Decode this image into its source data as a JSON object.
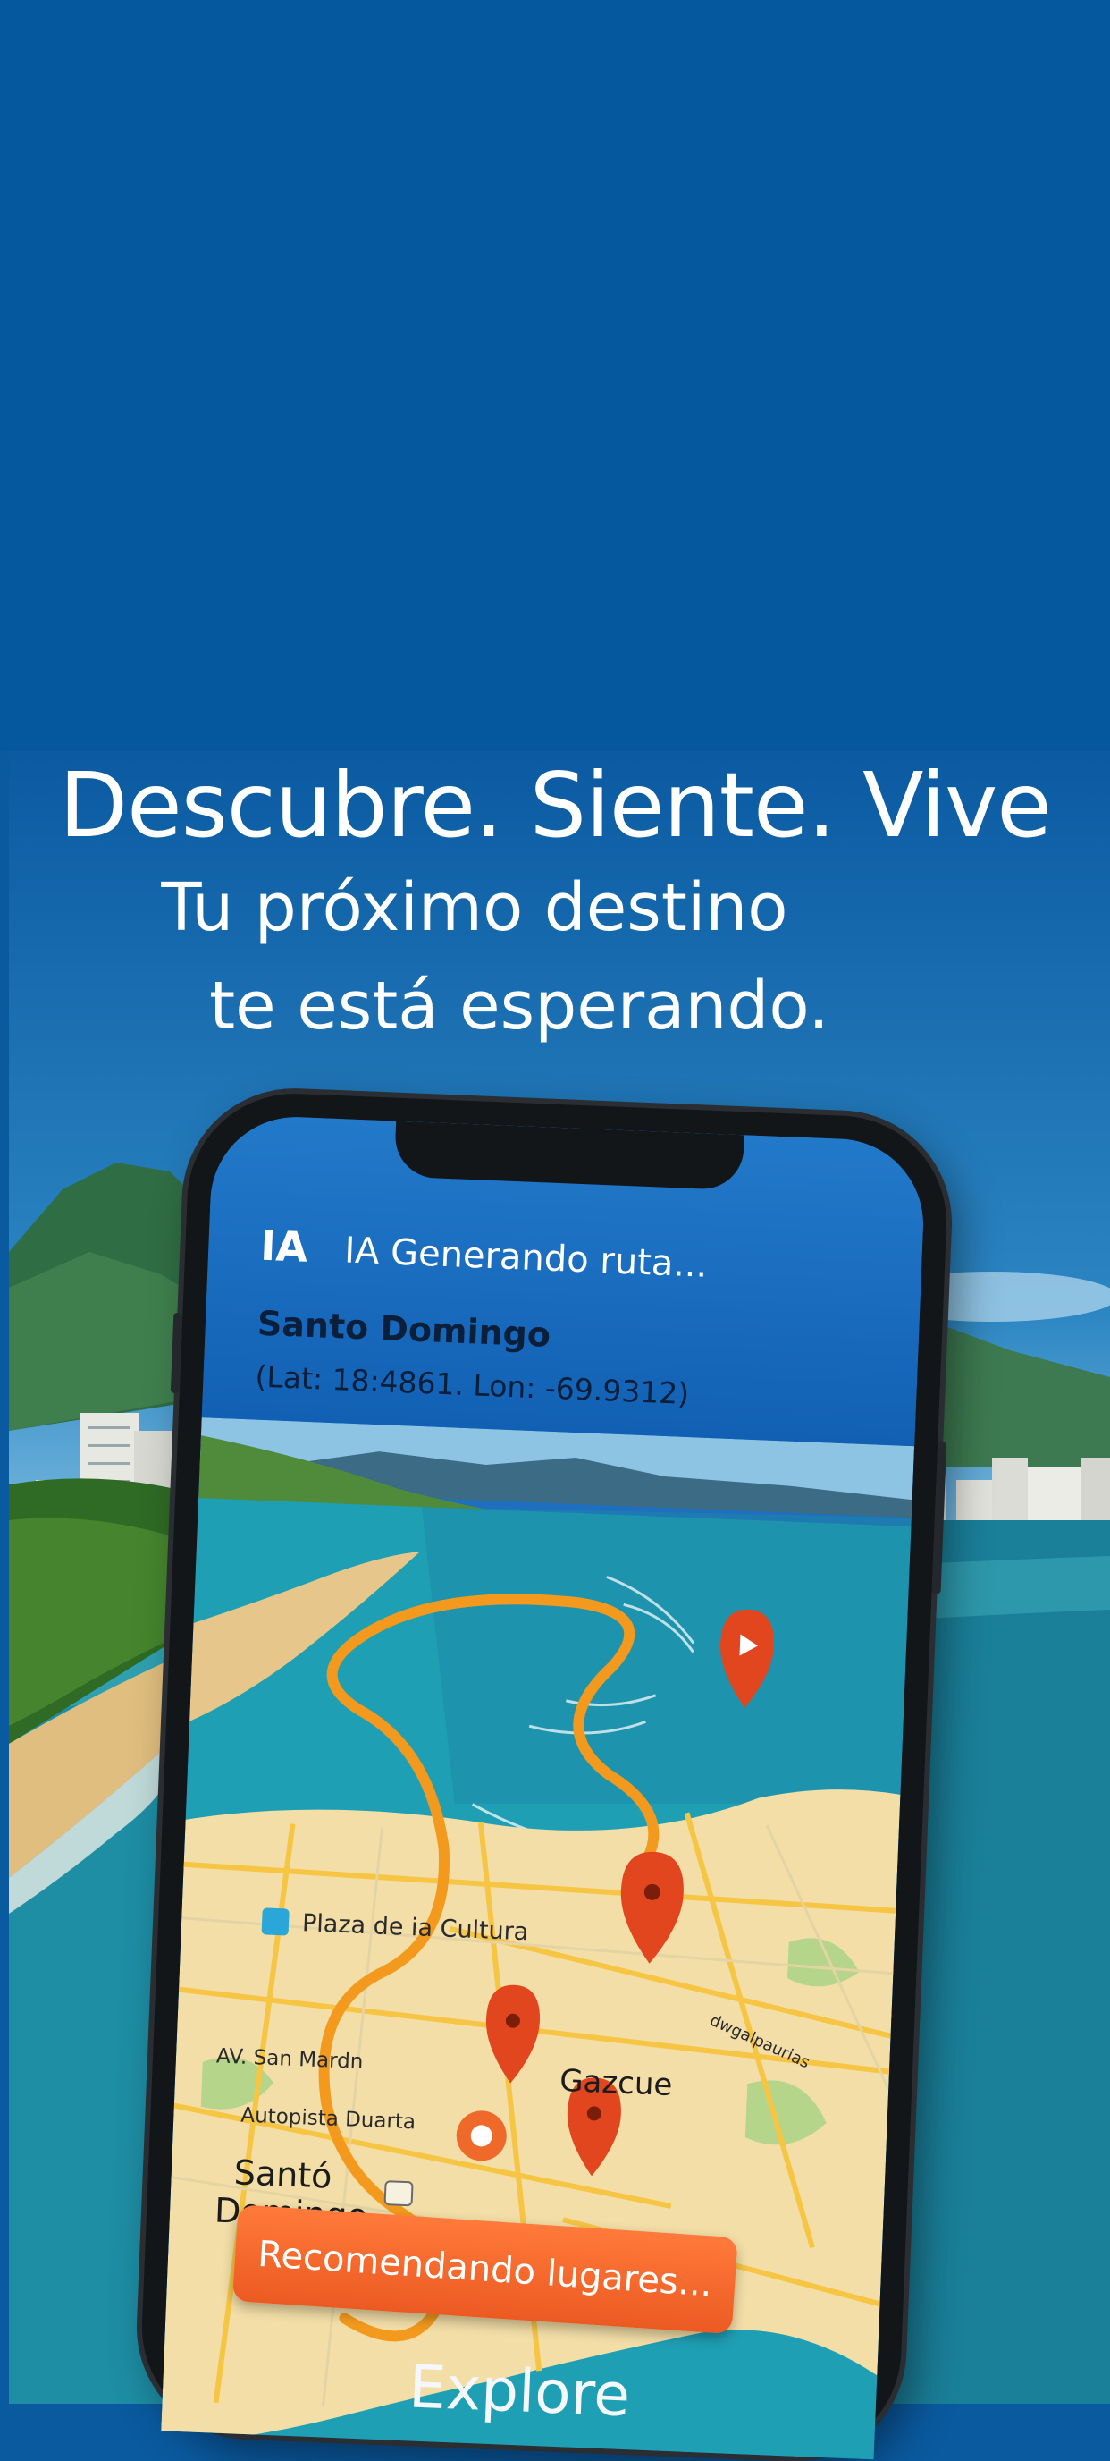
{
  "headline": {
    "title": "Descubre. Siente. Vive",
    "line1": "Tu próximo destino",
    "line2": "te está esperando."
  },
  "app": {
    "ia_badge": "IA",
    "route_status": "IA Generando ruta...",
    "location_name": "Santo Domingo",
    "coordinates": "(Lat: 18:4861. Lon: -69.9312)",
    "cta_label": "Recomendando lugares...",
    "bottom_label": "Explore"
  },
  "map": {
    "labels": {
      "plaza": "Plaza de ia Cultura",
      "av_san_martin": "AV. San Mardn",
      "autopista": "Autopista Duarta",
      "gazcue": "Gazcue",
      "santo": "Santó",
      "domingo": "Domingo",
      "diagonal_street": "dwgalpaurias"
    }
  },
  "colors": {
    "brand_blue": "#06589e",
    "route_orange": "#f39a1e",
    "pin_red": "#e2461e",
    "cta_orange": "#ef6226"
  }
}
